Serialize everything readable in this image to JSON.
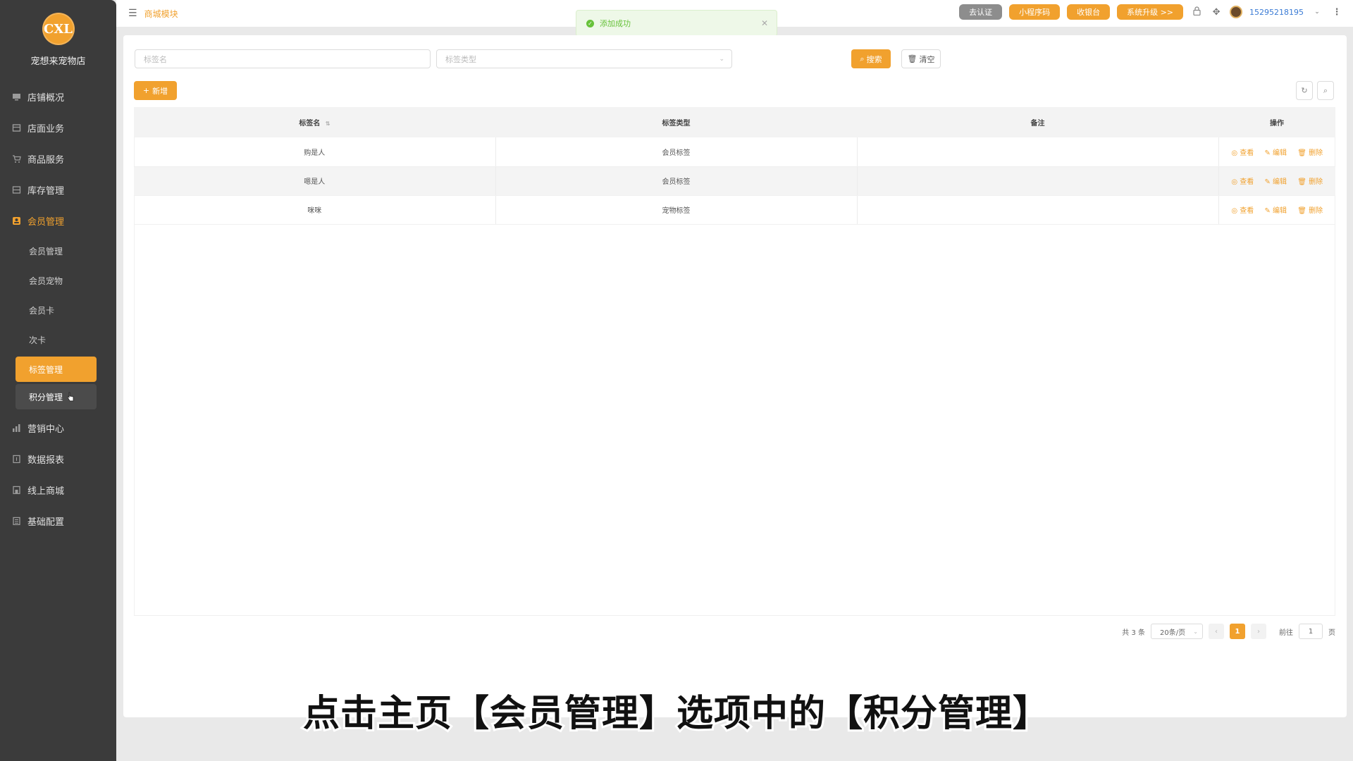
{
  "sidebar": {
    "logo_text": "CXL",
    "shop_name": "宠想来宠物店",
    "items": [
      {
        "label": "店铺概况"
      },
      {
        "label": "店面业务"
      },
      {
        "label": "商品服务"
      },
      {
        "label": "库存管理"
      },
      {
        "label": "会员管理"
      }
    ],
    "sub_items": [
      {
        "label": "会员管理"
      },
      {
        "label": "会员宠物"
      },
      {
        "label": "会员卡"
      },
      {
        "label": "次卡"
      },
      {
        "label": "标签管理"
      },
      {
        "label": "积分管理"
      }
    ],
    "items_after": [
      {
        "label": "营销中心"
      },
      {
        "label": "数据报表"
      },
      {
        "label": "线上商城"
      },
      {
        "label": "基础配置"
      }
    ]
  },
  "topbar": {
    "breadcrumb": "商城模块",
    "btn_auth": "去认证",
    "btn_miniprogram": "小程序码",
    "btn_cashier": "收银台",
    "btn_upgrade": "系统升级 >>",
    "phone": "15295218195"
  },
  "toast": {
    "message": "添加成功"
  },
  "filters": {
    "tag_name_placeholder": "标签名",
    "tag_type_placeholder": "标签类型",
    "search_label": "搜索",
    "clear_label": "清空",
    "add_label": "新增"
  },
  "table": {
    "headers": [
      "标签名",
      "标签类型",
      "备注",
      "操作"
    ],
    "rows": [
      {
        "name": "购是人",
        "type": "会员标签",
        "remark": ""
      },
      {
        "name": "嗯是人",
        "type": "会员标签",
        "remark": ""
      },
      {
        "name": "咪咪",
        "type": "宠物标签",
        "remark": ""
      }
    ],
    "actions": {
      "view": "查看",
      "edit": "编辑",
      "delete": "删除"
    }
  },
  "pagination": {
    "total": "共 3 条",
    "page_size": "20条/页",
    "current_page": "1",
    "goto_label": "前往",
    "goto_value": "1",
    "page_unit": "页"
  },
  "caption": "点击主页【会员管理】选项中的【积分管理】",
  "colors": {
    "accent": "#f1a12e",
    "sidebar_bg": "#3b3b3b",
    "success": "#67c23a"
  }
}
